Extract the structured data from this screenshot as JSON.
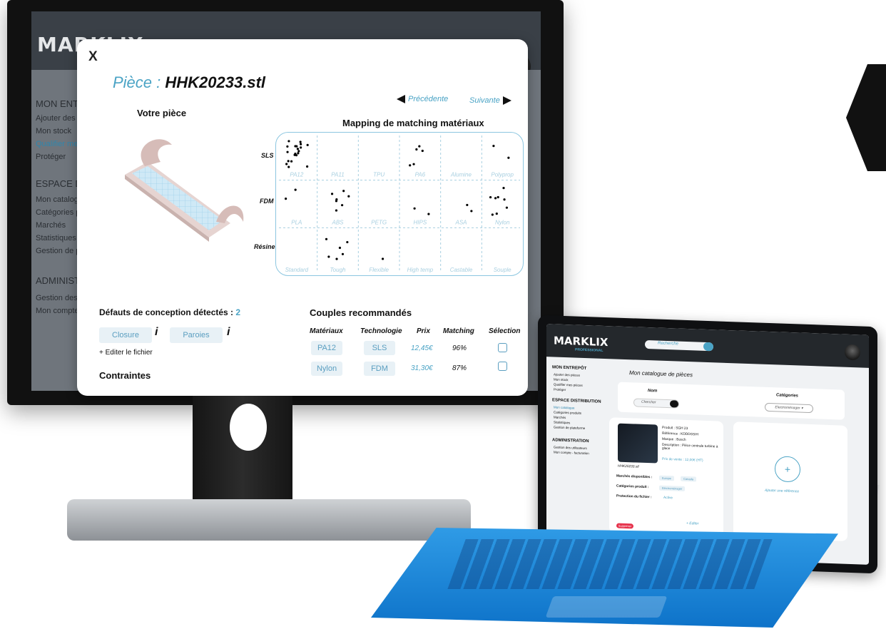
{
  "monitor": {
    "logo": "MARKLIX",
    "sidebar": {
      "section1_title": "MON ENTREPÔT",
      "section1_items": [
        "Ajouter des pièces",
        "Mon stock",
        "Qualifier mes pièces",
        "Protéger"
      ],
      "section2_title": "ESPACE DISTRIBUTION",
      "section2_items": [
        "Mon catalogue",
        "Catégories produits",
        "Marchés",
        "Statistiques",
        "Gestion de plateforme"
      ],
      "section3_title": "ADMINISTRATION",
      "section3_items": [
        "Gestion des utilisateurs",
        "Mon compte - facturation"
      ]
    }
  },
  "modal": {
    "close_label": "X",
    "title_label": "Pièce :",
    "title_value": "HHK20233.stl",
    "prev_label": "Précédente",
    "next_label": "Suivante",
    "your_piece": "Votre pièce",
    "mapping_title": "Mapping de matching matériaux",
    "defects_title": "Défauts de conception détectés :",
    "defects_count": "2",
    "defects": [
      "Closure",
      "Paroies"
    ],
    "info_glyph": "i",
    "edit_file": "+ Editer le fichier",
    "constraints_title": "Contraintes",
    "couples_title": "Couples recommandés",
    "table_headers": [
      "Matériaux",
      "Technologie",
      "Prix",
      "Matching",
      "Sélection"
    ],
    "rows": [
      {
        "material": "PA12",
        "tech": "SLS",
        "price": "12,45€",
        "match": "96%"
      },
      {
        "material": "Nylon",
        "tech": "FDM",
        "price": "31,30€",
        "match": "87%"
      }
    ]
  },
  "chart_data": {
    "type": "scatter",
    "title": "Mapping de matching matériaux",
    "rows": [
      "SLS",
      "FDM",
      "Résine"
    ],
    "cells": [
      [
        "PA12",
        "PA11",
        "TPU",
        "PA6",
        "Alumine",
        "Polyprop"
      ],
      [
        "PLA",
        "ABS",
        "PETG",
        "HIPS",
        "ASA",
        "Nylon"
      ],
      [
        "Standard",
        "Tough",
        "Flexible",
        "High temp",
        "Castable",
        "Souple"
      ]
    ],
    "dot_counts": [
      [
        20,
        0,
        0,
        5,
        0,
        2
      ],
      [
        2,
        7,
        0,
        2,
        2,
        8
      ],
      [
        0,
        6,
        1,
        0,
        0,
        0
      ]
    ],
    "grid": true
  },
  "tablet": {
    "logo": "MARKLIX",
    "logo_sub": "PROFESSIONAL",
    "search_placeholder": "Recherche",
    "sidebar": {
      "section1_title": "MON ENTREPÔT",
      "section1_items": [
        "Ajouter des pièces",
        "Mon stock",
        "Qualifier mes pièces",
        "Protéger"
      ],
      "section2_title": "ESPACE DISTRIBUTION",
      "section2_items": [
        "Mon catalogue",
        "Catégories produits",
        "Marchés",
        "Statistiques",
        "Gestion de plateforme"
      ],
      "section3_title": "ADMINISTRATION",
      "section3_items": [
        "Gestion des utilisateurs",
        "Mon compte - facturation"
      ]
    },
    "page_title": "Mon catalogue de pièces",
    "filter_name_label": "Nom",
    "filter_cat_label": "Catégories",
    "chercher_placeholder": "Chercher",
    "category_value": "Electroménager ▾",
    "card": {
      "produit": "Produit : SGH 23",
      "reference": "Référence : KDDDSSIH",
      "marque": "Marque : Bosch",
      "description": "Description : Pièce centrale turbine à glace",
      "prix": "Prix de vente : 12,00€ (HT)",
      "filename": "HHK20233.stl",
      "marches_label": "Marchés disponibles :",
      "marches": [
        "Europe",
        "Canada"
      ],
      "categories_label": "Catégories produit :",
      "categories": [
        "Electroménager"
      ],
      "protection_label": "Protection du fichier :",
      "protection_value": "Active",
      "delete": "Supprimer",
      "edit": "+ Editer"
    },
    "add_label": "Ajouter une référence",
    "plus": "+"
  }
}
